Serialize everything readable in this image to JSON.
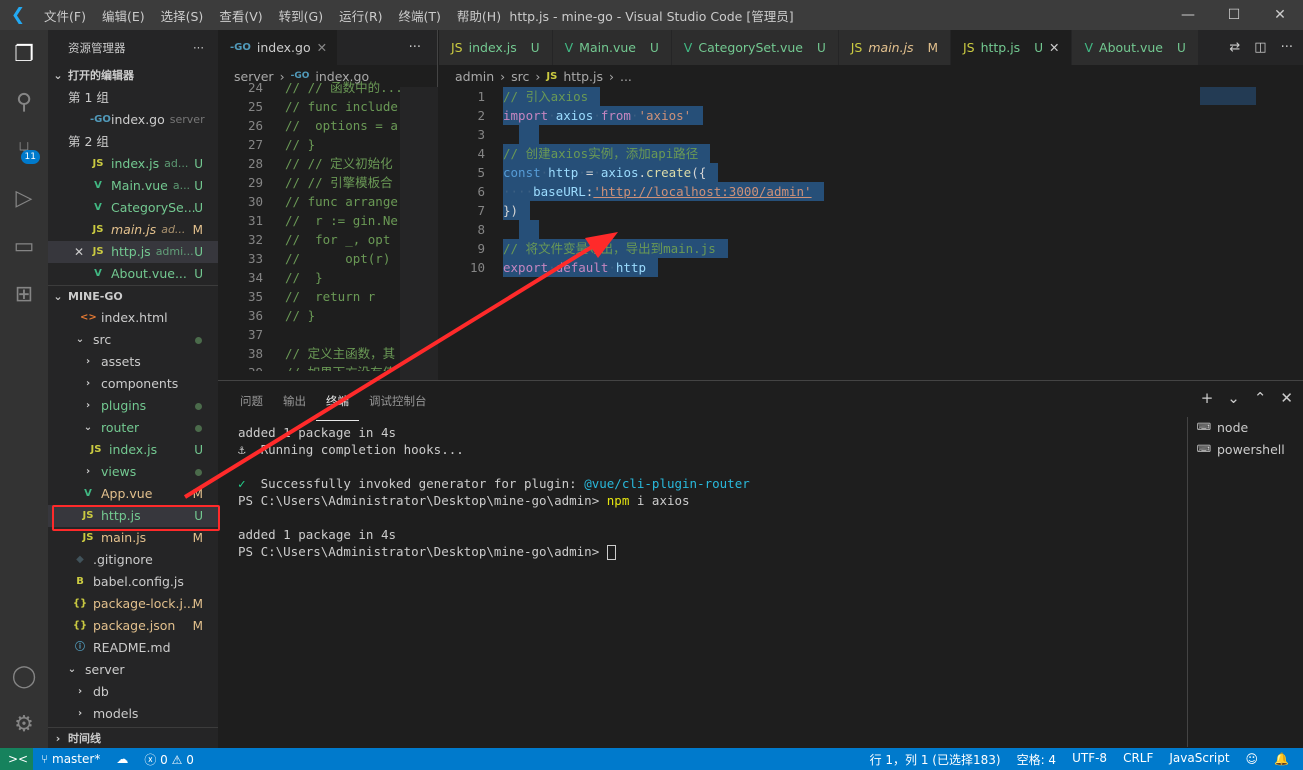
{
  "window": {
    "title": "http.js - mine-go - Visual Studio Code [管理员]",
    "menu": [
      "文件(F)",
      "编辑(E)",
      "选择(S)",
      "查看(V)",
      "转到(G)",
      "运行(R)",
      "终端(T)",
      "帮助(H)"
    ],
    "controls": [
      "—",
      "☐",
      "✕"
    ]
  },
  "activity": [
    {
      "name": "explorer-icon",
      "glyph": "❐",
      "active": true
    },
    {
      "name": "search-icon",
      "glyph": "⚲"
    },
    {
      "name": "source-control-icon",
      "glyph": "⑂",
      "badge": "11"
    },
    {
      "name": "run-debug-icon",
      "glyph": "▷"
    },
    {
      "name": "remote-explorer-icon",
      "glyph": "▭"
    },
    {
      "name": "extensions-icon",
      "glyph": "⊞"
    }
  ],
  "activity_bottom": [
    {
      "name": "account-icon",
      "glyph": "◯"
    },
    {
      "name": "settings-gear-icon",
      "glyph": "⚙"
    }
  ],
  "sidebar": {
    "title": "资源管理器",
    "more": "···",
    "open_editors": {
      "label": "打开的编辑器",
      "items": [
        {
          "type": "group",
          "name": "第 1 组"
        },
        {
          "type": "file",
          "icon": "go",
          "name": "index.go",
          "desc": "server"
        },
        {
          "type": "group",
          "name": "第 2 组"
        },
        {
          "type": "file",
          "icon": "js",
          "name": "index.js",
          "desc": "ad...",
          "status": "U"
        },
        {
          "type": "file",
          "icon": "vue",
          "name": "Main.vue",
          "desc": "a...",
          "status": "U"
        },
        {
          "type": "file",
          "icon": "vue",
          "name": "CategorySe...",
          "desc": "",
          "status": "U"
        },
        {
          "type": "file",
          "icon": "js",
          "name": "main.js",
          "desc": "ad...",
          "status": "M",
          "italic": true
        },
        {
          "type": "file",
          "icon": "js",
          "name": "http.js",
          "desc": "admi...",
          "status": "U",
          "selected": true,
          "close": "✕"
        },
        {
          "type": "file",
          "icon": "vue",
          "name": "About.vue...",
          "desc": "",
          "status": "U"
        }
      ]
    },
    "project": {
      "label": "MINE-GO",
      "items": [
        {
          "level": 2,
          "icon": "html",
          "name": "index.html"
        },
        {
          "level": 1,
          "folder": "open",
          "name": "src",
          "dot": true
        },
        {
          "level": 2,
          "folder": "closed",
          "name": "assets"
        },
        {
          "level": 2,
          "folder": "closed",
          "name": "components"
        },
        {
          "level": 2,
          "folder": "closed",
          "name": "plugins",
          "dot": true,
          "status_color": "untracked"
        },
        {
          "level": 2,
          "folder": "open",
          "name": "router",
          "dot": true,
          "status_color": "untracked"
        },
        {
          "level": 3,
          "icon": "js",
          "name": "index.js",
          "status": "U"
        },
        {
          "level": 2,
          "folder": "closed",
          "name": "views",
          "dot": true,
          "status_color": "untracked"
        },
        {
          "level": 2,
          "icon": "vue",
          "name": "App.vue",
          "status": "M"
        },
        {
          "level": 2,
          "icon": "js",
          "name": "http.js",
          "status": "U",
          "highlighted": true
        },
        {
          "level": 2,
          "icon": "js",
          "name": "main.js",
          "status": "M"
        },
        {
          "level": 1,
          "icon": "git",
          "name": ".gitignore"
        },
        {
          "level": 1,
          "icon": "babel",
          "name": "babel.config.js"
        },
        {
          "level": 1,
          "icon": "json",
          "name": "package-lock.j...",
          "status": "M"
        },
        {
          "level": 1,
          "icon": "json",
          "name": "package.json",
          "status": "M"
        },
        {
          "level": 1,
          "icon": "info",
          "name": "README.md"
        },
        {
          "level": 0,
          "folder": "open",
          "name": "server"
        },
        {
          "level": 1,
          "folder": "closed",
          "name": "db"
        },
        {
          "level": 1,
          "folder": "closed",
          "name": "models"
        }
      ]
    },
    "timeline": "时间线"
  },
  "left_editor": {
    "tab": {
      "label": "index.go",
      "close": "✕"
    },
    "more": "···",
    "breadcrumb": [
      "server",
      "index.go"
    ],
    "lines": [
      [
        "24",
        "// // 函数中的..."
      ],
      [
        "25",
        "// func include"
      ],
      [
        "26",
        "//  options = a"
      ],
      [
        "27",
        "// }"
      ],
      [
        "28",
        "// // 定义初始化"
      ],
      [
        "29",
        "// // 引擎模板合"
      ],
      [
        "30",
        "// func arrange"
      ],
      [
        "31",
        "//  r := gin.Ne"
      ],
      [
        "32",
        "//  for _, opt "
      ],
      [
        "33",
        "//      opt(r)"
      ],
      [
        "34",
        "//  }"
      ],
      [
        "35",
        "//  return r"
      ],
      [
        "36",
        "// }"
      ],
      [
        "37",
        ""
      ],
      [
        "38",
        "// 定义主函数，其"
      ],
      [
        "39",
        "// 如果下方没有值"
      ]
    ]
  },
  "right_editor": {
    "tabs": [
      {
        "icon": "js",
        "label": "index.js",
        "status": "U"
      },
      {
        "icon": "vue",
        "label": "Main.vue",
        "status": "U"
      },
      {
        "icon": "vue",
        "label": "CategorySet.vue",
        "status": "U"
      },
      {
        "icon": "js",
        "label": "main.js",
        "status": "M",
        "italic": true
      },
      {
        "icon": "js",
        "label": "http.js",
        "status": "U",
        "active": true,
        "close": "✕"
      },
      {
        "icon": "vue",
        "label": "About.vue",
        "status": "U"
      }
    ],
    "actions": [
      {
        "name": "open-changes-icon",
        "glyph": "⇄"
      },
      {
        "name": "split-editor-icon",
        "glyph": "◫"
      },
      {
        "name": "more-actions-icon",
        "glyph": "···"
      }
    ],
    "breadcrumb": [
      "admin",
      "src",
      "http.js",
      "..."
    ],
    "lines": [
      [
        [
          "cm",
          "// 引入axios"
        ]
      ],
      [
        [
          "kw",
          "import"
        ],
        [
          "ws",
          "·"
        ],
        [
          "va",
          "axios"
        ],
        [
          "ws",
          "·"
        ],
        [
          "kw",
          "from"
        ],
        [
          "ws",
          "·"
        ],
        [
          "str",
          "'axios'"
        ]
      ],
      [],
      [
        [
          "cm",
          "// 创建axios实例，添加api路径"
        ]
      ],
      [
        [
          "kb",
          "const"
        ],
        [
          "ws",
          "·"
        ],
        [
          "va",
          "http"
        ],
        [
          "ws",
          "·"
        ],
        [
          "p",
          "="
        ],
        [
          "ws",
          "·"
        ],
        [
          "va",
          "axios"
        ],
        [
          "p",
          "."
        ],
        [
          "fn",
          "create"
        ],
        [
          "p",
          "({"
        ]
      ],
      [
        [
          "ws",
          "····"
        ],
        [
          "va",
          "baseURL"
        ],
        [
          "p",
          ":"
        ],
        [
          "str",
          "'http://localhost:3000/admin'"
        ]
      ],
      [
        [
          "p",
          "})"
        ]
      ],
      [],
      [
        [
          "cm",
          "// 将文件变量导出，导出到main.js"
        ]
      ],
      [
        [
          "kw",
          "export"
        ],
        [
          "ws",
          "·"
        ],
        [
          "kw",
          "default"
        ],
        [
          "ws",
          "·"
        ],
        [
          "va",
          "http"
        ]
      ]
    ]
  },
  "panel": {
    "tabs": [
      "问题",
      "输出",
      "终端",
      "调试控制台"
    ],
    "active": "终端",
    "actions": [
      "+",
      "⌄",
      "⌃",
      "✕"
    ],
    "terminal": [
      [
        [
          "t",
          "added 1 package in 4s"
        ]
      ],
      [
        [
          "t",
          "⚓  Running completion hooks..."
        ]
      ],
      [],
      [
        [
          "ok",
          "✓"
        ],
        [
          "t",
          "  Successfully invoked generator for plugin: "
        ],
        [
          "link",
          "@vue/cli-plugin-router"
        ]
      ],
      [
        [
          "t",
          "PS C:\\Users\\Administrator\\Desktop\\mine-go\\admin> "
        ],
        [
          "cmd",
          "npm"
        ],
        [
          "t",
          " i axios"
        ]
      ],
      [],
      [
        [
          "t",
          "added 1 package in 4s"
        ]
      ],
      [
        [
          "t",
          "PS C:\\Users\\Administrator\\Desktop\\mine-go\\admin> "
        ],
        [
          "cursor",
          " "
        ]
      ]
    ],
    "terminals": [
      "node",
      "powershell"
    ]
  },
  "statusbar": {
    "remote": "><",
    "branch": "master*",
    "sync": "☁",
    "errors": "0",
    "warnings": "0",
    "right": [
      "行 1，列 1 (已选择183)",
      "空格: 4",
      "UTF-8",
      "CRLF",
      "JavaScript"
    ],
    "feedback": "☺",
    "bell": "🔔"
  },
  "colors": {
    "accent": "#007acc",
    "untracked": "#73c991",
    "modified": "#e2c08d",
    "annotation": "#ff2a2a",
    "remote": "#16825d"
  }
}
